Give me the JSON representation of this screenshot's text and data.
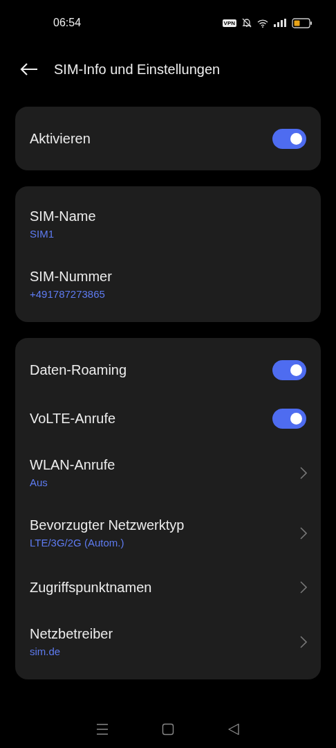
{
  "status_bar": {
    "time": "06:54",
    "vpn": "VPN"
  },
  "header": {
    "title": "SIM-Info und Einstellungen"
  },
  "cards": [
    {
      "rows": [
        {
          "kind": "toggle",
          "label": "Aktivieren",
          "on": true
        }
      ]
    },
    {
      "rows": [
        {
          "kind": "info",
          "label": "SIM-Name",
          "value": "SIM1"
        },
        {
          "kind": "info",
          "label": "SIM-Nummer",
          "value": "+491787273865"
        }
      ]
    },
    {
      "rows": [
        {
          "kind": "toggle",
          "label": "Daten-Roaming",
          "on": true
        },
        {
          "kind": "toggle",
          "label": "VoLTE-Anrufe",
          "on": true
        },
        {
          "kind": "link",
          "label": "WLAN-Anrufe",
          "value": "Aus"
        },
        {
          "kind": "link",
          "label": "Bevorzugter Netzwerktyp",
          "value": "LTE/3G/2G (Autom.)"
        },
        {
          "kind": "link",
          "label": "Zugriffspunktnamen"
        },
        {
          "kind": "link",
          "label": "Netzbetreiber",
          "value": "sim.de"
        }
      ]
    }
  ]
}
